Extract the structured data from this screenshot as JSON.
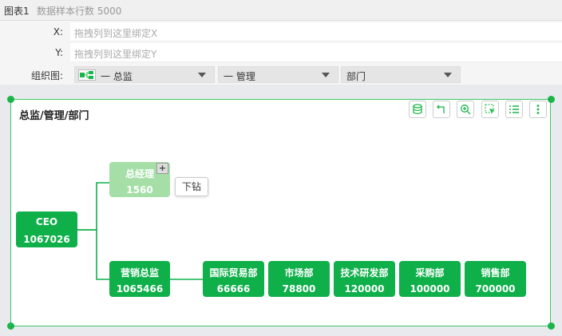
{
  "header": {
    "chart_title": "图表1",
    "sample_info": "数据样本行数 5000"
  },
  "shelves": {
    "x": {
      "label": "X:",
      "placeholder": "拖拽列到这里绑定X"
    },
    "y": {
      "label": "Y:",
      "placeholder": "拖拽列到这里绑定Y"
    },
    "org": {
      "label": "组织图:",
      "fields": [
        "一  总监",
        "一  管理",
        "部门"
      ]
    }
  },
  "chart": {
    "title": "总监/管理/部门",
    "toolbar": [
      "database-icon",
      "undo-icon",
      "zoom-in-icon",
      "select-icon",
      "list-icon",
      "more-icon"
    ],
    "drill_label": "下钻",
    "plus_label": "+"
  },
  "chart_data": {
    "type": "org-tree",
    "root": {
      "name": "CEO",
      "value": 1067026
    },
    "children": [
      {
        "name": "总经理",
        "value": 1560,
        "collapsed": true
      },
      {
        "name": "营销总监",
        "value": 1065466,
        "children": [
          {
            "name": "国际贸易部",
            "value": 66666
          },
          {
            "name": "市场部",
            "value": 78800
          },
          {
            "name": "技术研发部",
            "value": 120000
          },
          {
            "name": "采购部",
            "value": 100000
          },
          {
            "name": "销售部",
            "value": 700000
          }
        ]
      }
    ],
    "colors": {
      "node": "#0fb04a",
      "collapsed_node": "#a5dfa7",
      "link": "#0fb04a"
    }
  }
}
